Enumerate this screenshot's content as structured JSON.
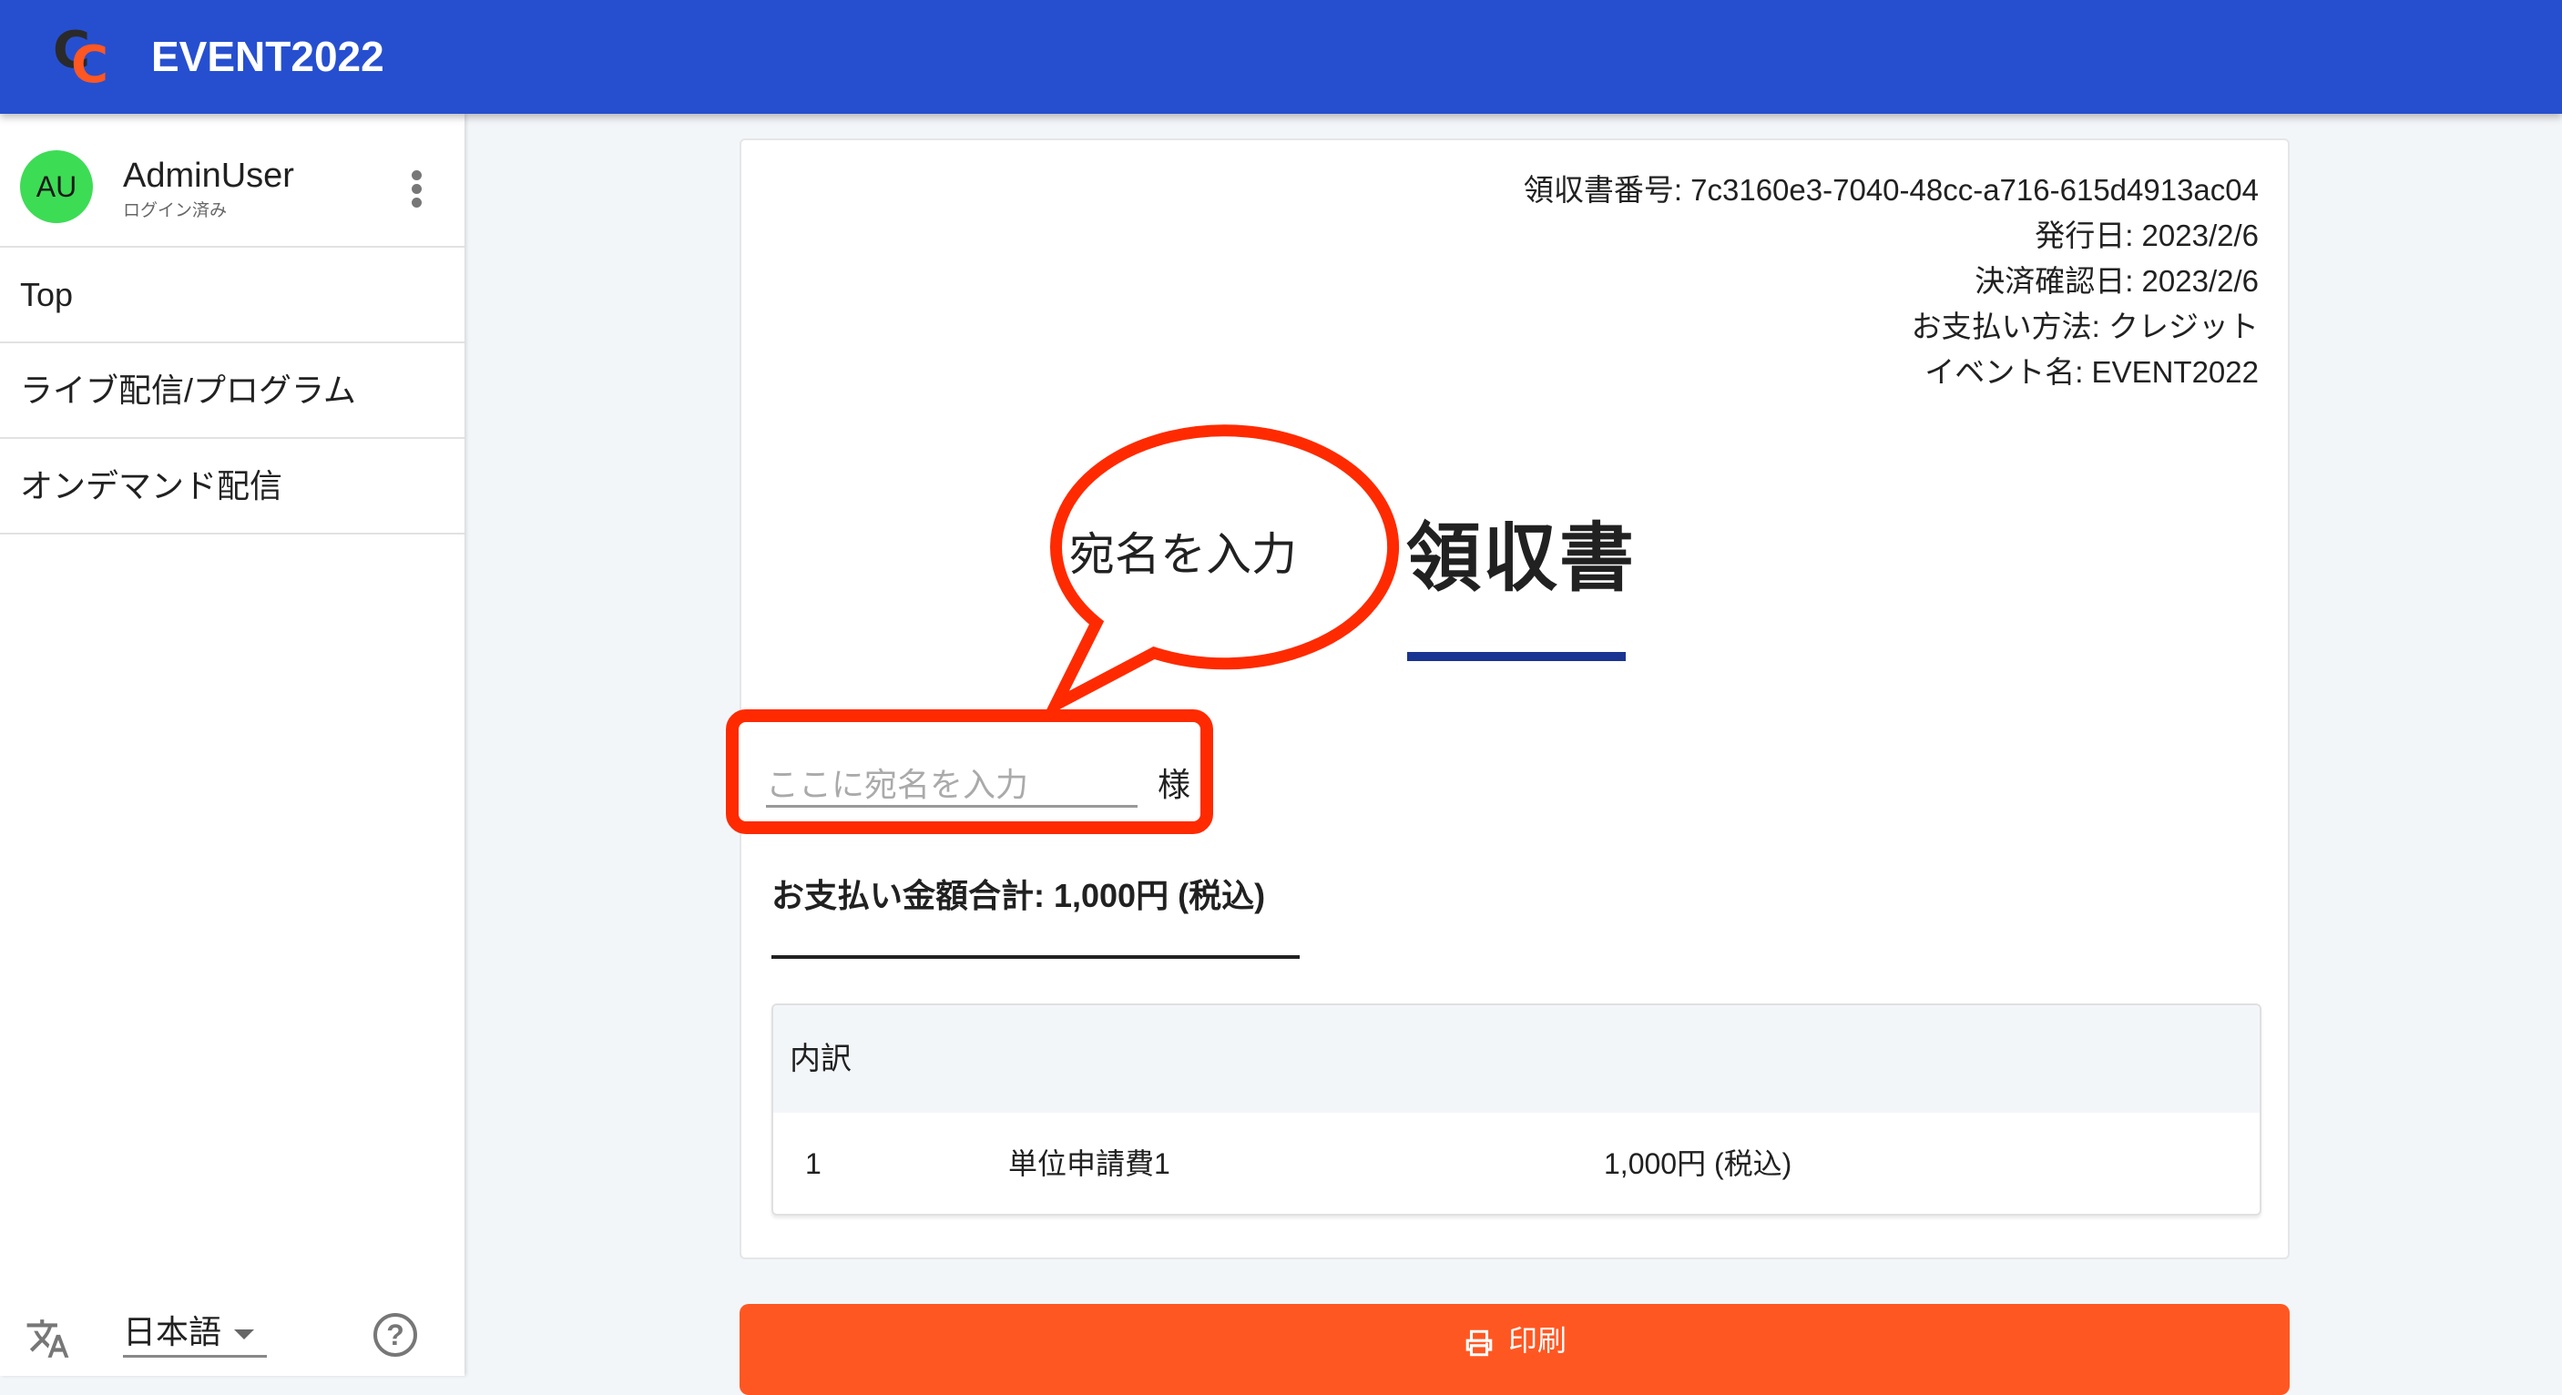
{
  "header": {
    "logo_letters": [
      "C",
      "C"
    ],
    "title": "EVENT2022",
    "color": "#264fd0"
  },
  "sidebar": {
    "user": {
      "initials": "AU",
      "name": "AdminUser",
      "status": "ログイン済み",
      "avatar_color": "#3ddc55"
    },
    "items": [
      {
        "label": "Top"
      },
      {
        "label": "ライブ配信/プログラム"
      },
      {
        "label": "オンデマンド配信"
      }
    ],
    "footer": {
      "language": "日本語",
      "help_symbol": "?"
    }
  },
  "receipt": {
    "meta": [
      "領収書番号: 7c3160e3-7040-48cc-a716-615d4913ac04",
      "発行日: 2023/2/6",
      "決済確認日: 2023/2/6",
      "お支払い方法: クレジット",
      "イベント名: EVENT2022"
    ],
    "title": "領収書",
    "callout": "宛名を入力",
    "name_input": {
      "value": "",
      "placeholder": "ここに宛名を入力"
    },
    "honorific": "様",
    "total": "お支払い金額合計: 1,000円 (税込)",
    "breakdown": {
      "header": "内訳",
      "rows": [
        {
          "no": "1",
          "item": "単位申請費1",
          "amount": "1,000円 (税込)"
        }
      ]
    },
    "accent_colors": {
      "title_underline": "#1a3591",
      "highlight": "#ff2a00"
    }
  },
  "print_button": {
    "label": "印刷",
    "color": "#ff5722"
  }
}
